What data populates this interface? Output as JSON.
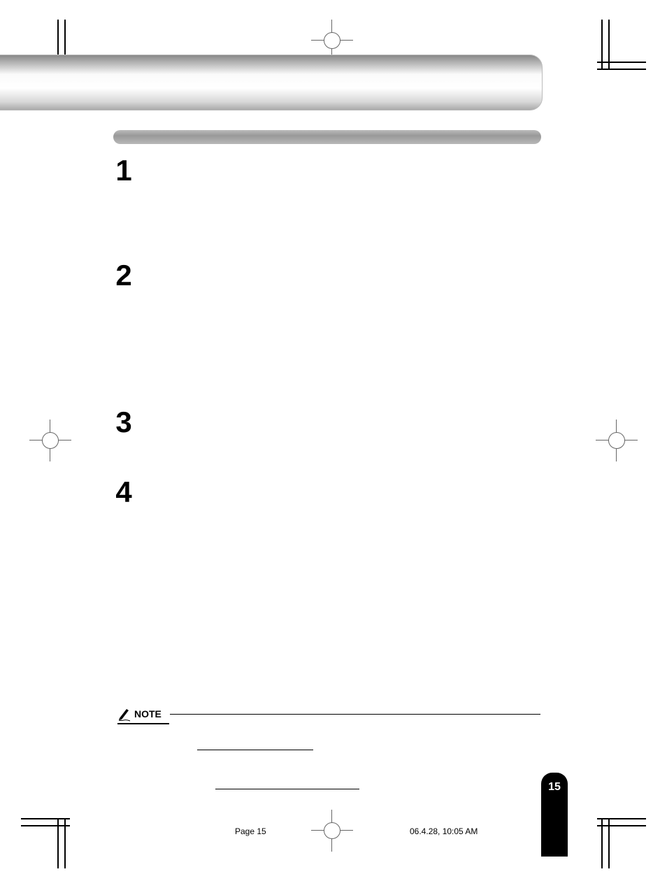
{
  "steps": [
    "1",
    "2",
    "3",
    "4"
  ],
  "note_label": "NOTE",
  "page_tab": "15",
  "footer_page": "Page 15",
  "footer_date": "06.4.28, 10:05 AM"
}
